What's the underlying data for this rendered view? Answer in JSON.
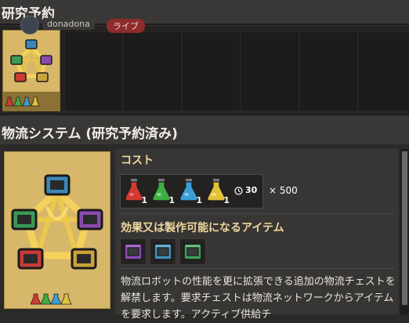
{
  "research_queue": {
    "title": "研究予約",
    "owner": {
      "name": "donadona",
      "status_badge": "ライブ"
    },
    "items": [
      {
        "technology": "logistic-system",
        "icon": "logistic-system-tech-icon",
        "flask_icons": [
          "red-science-pack-icon",
          "green-science-pack-icon",
          "blue-science-pack-icon",
          "yellow-science-pack-icon"
        ]
      }
    ]
  },
  "technology": {
    "title": "物流システム (研究予約済み)",
    "icon": "logistic-system-tech-icon",
    "cost": {
      "label": "コスト",
      "ingredients": [
        {
          "icon": "red-science-pack-icon",
          "count": "1",
          "color": "#d23a34"
        },
        {
          "icon": "green-science-pack-icon",
          "count": "1",
          "color": "#3fae46"
        },
        {
          "icon": "blue-science-pack-icon",
          "count": "1",
          "color": "#3a9fd8"
        },
        {
          "icon": "yellow-science-pack-icon",
          "count": "1",
          "color": "#e4c13b"
        }
      ],
      "time": "30",
      "time_icon": "clock-icon",
      "multiplier": "× 500"
    },
    "effects": {
      "label": "効果又は製作可能になるアイテム",
      "items": [
        {
          "icon": "active-provider-chest-icon",
          "color": "#8a4bb0"
        },
        {
          "icon": "requester-chest-icon",
          "color": "#3f8fb5"
        },
        {
          "icon": "buffer-chest-icon",
          "color": "#3c9a57"
        }
      ]
    },
    "description": "物流ロボットの性能を更に拡張できる追加の物流チェストを解禁します。要求チェストは物流ネットワークからアイテムを要求します。アクティブ供給チ"
  },
  "colors": {
    "header_bg": "#393837",
    "panel_bg": "#373635",
    "card_gold": "#d7b76a",
    "heading_gold": "#f1d79b",
    "live_red": "#8e2b2b"
  }
}
